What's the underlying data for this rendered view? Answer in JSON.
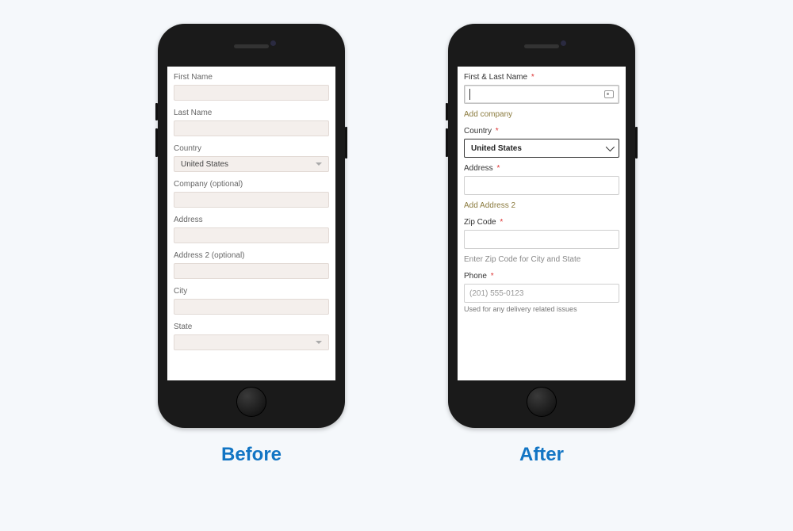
{
  "before": {
    "caption": "Before",
    "fields": {
      "first_name": "First Name",
      "last_name": "Last Name",
      "country": "Country",
      "country_value": "United States",
      "company": "Company (optional)",
      "address": "Address",
      "address2": "Address 2 (optional)",
      "city": "City",
      "state": "State"
    }
  },
  "after": {
    "caption": "After",
    "fields": {
      "name_label": "First & Last Name",
      "add_company": "Add company",
      "country_label": "Country",
      "country_value": "United States",
      "address_label": "Address",
      "add_address2": "Add Address 2",
      "zip_label": "Zip Code",
      "zip_hint": "Enter Zip Code for City and State",
      "phone_label": "Phone",
      "phone_placeholder": "(201) 555-0123",
      "phone_helper": "Used for any delivery related issues"
    }
  },
  "required_marker": "*"
}
